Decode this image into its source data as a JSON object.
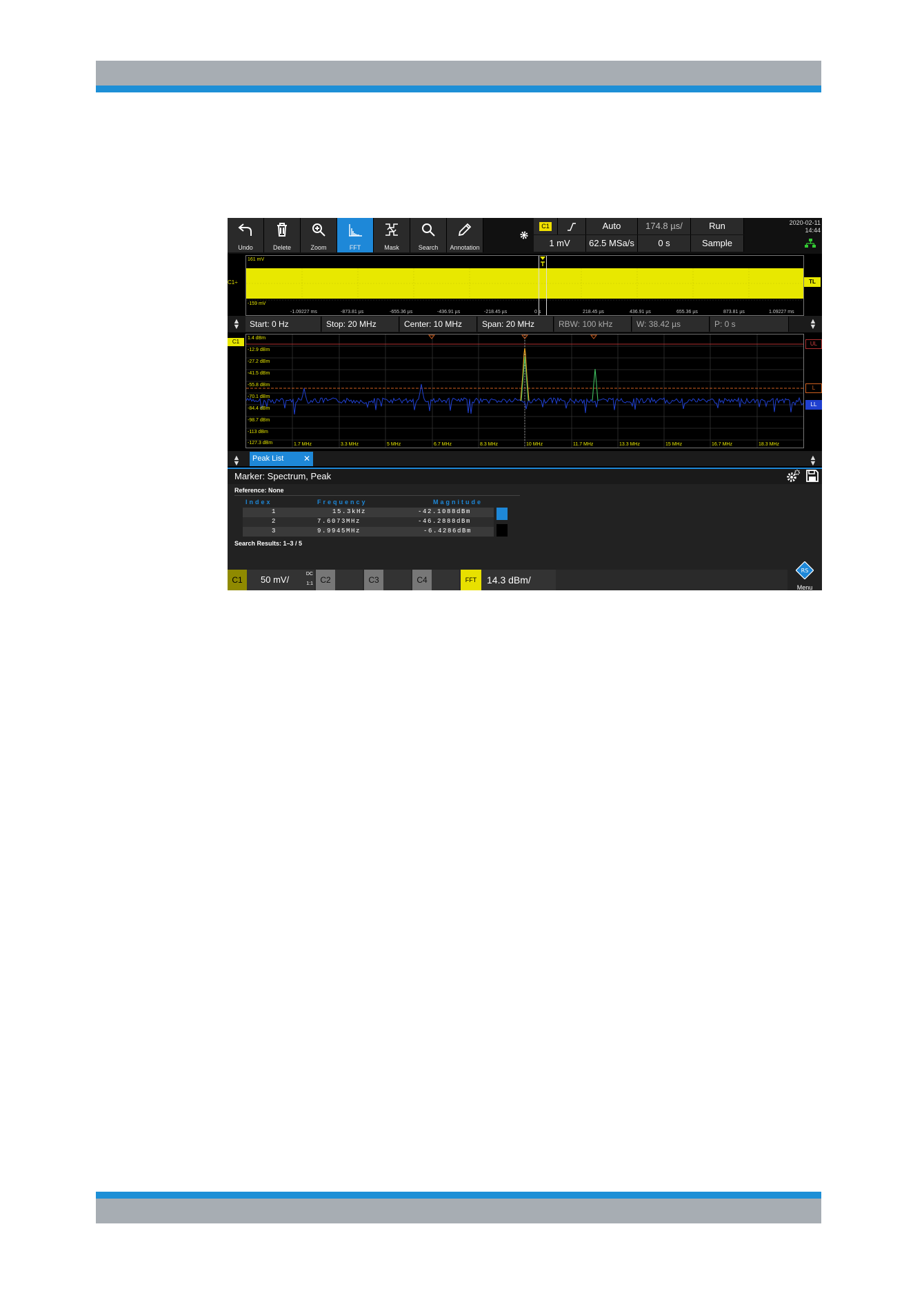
{
  "toolbar": {
    "buttons": [
      {
        "label": "Undo",
        "icon": "undo-icon"
      },
      {
        "label": "Delete",
        "icon": "trash-icon"
      },
      {
        "label": "Zoom",
        "icon": "zoom-icon"
      },
      {
        "label": "FFT",
        "icon": "fft-icon",
        "active": true
      },
      {
        "label": "Mask",
        "icon": "mask-icon"
      },
      {
        "label": "Search",
        "icon": "search-icon"
      },
      {
        "label": "Annotation",
        "icon": "pen-icon"
      }
    ],
    "accent_color": "#1e88d8"
  },
  "trigger": {
    "source": "C1",
    "mode": "Auto",
    "time_scale": "174.8 µs/",
    "run": "Run",
    "level": "1 mV",
    "sample_rate": "62.5 MSa/s",
    "position": "0 s",
    "acquire": "Sample"
  },
  "datetime": {
    "date": "2020-02-11",
    "time": "14:44"
  },
  "waveform": {
    "top_label": "161 mV",
    "bottom_label": "-159 mV",
    "channel": "C1",
    "trigger_level_tag": "TL",
    "channel_color": "#e8e800",
    "time_ticks": [
      "-1.09227 ms",
      "-873.81 µs",
      "-655.36 µs",
      "-436.91 µs",
      "-218.45 µs",
      "0 s",
      "218.45 µs",
      "436.91 µs",
      "655.36 µs",
      "873.81 µs",
      "1.09227 ms"
    ]
  },
  "spectrum_bar": {
    "start": "Start: 0 Hz",
    "stop": "Stop: 20 MHz",
    "center": "Center: 10 MHz",
    "span": "Span: 20 MHz",
    "rbw": "RBW: 100 kHz",
    "w": "W: 38.42 µs",
    "p": "P: 0 s"
  },
  "spectrum": {
    "y_labels": [
      "1.4 dBm",
      "-12.9 dBm",
      "-27.2 dBm",
      "-41.5 dBm",
      "-55.8 dBm",
      "-70.1 dBm",
      "-84.4 dBm",
      "-98.7 dBm",
      "-113 dBm",
      "-127.3 dBm"
    ],
    "x_labels": [
      "1.7 MHz",
      "3.3 MHz",
      "5 MHz",
      "6.7 MHz",
      "8.3 MHz",
      "10 MHz",
      "11.7 MHz",
      "13.3 MHz",
      "15 MHz",
      "16.7 MHz",
      "18.3 MHz"
    ],
    "channel": "C1",
    "ul_tag": "UL",
    "l_tag": "L",
    "ll_tag": "LL",
    "trace_color": "#2040d0"
  },
  "peak_list": {
    "tab_label": "Peak List",
    "title": "Marker: Spectrum, Peak",
    "reference": "Reference: None",
    "columns": [
      "Index",
      "Frequency",
      "Magnitude"
    ],
    "rows": [
      {
        "index": "1",
        "frequency": "15.3kHz",
        "magnitude": "-42.1088dBm"
      },
      {
        "index": "2",
        "frequency": "7.6073MHz",
        "magnitude": "-46.2888dBm"
      },
      {
        "index": "3",
        "frequency": "9.9945MHz",
        "magnitude": "-6.4286dBm"
      }
    ],
    "results": "Search Results:  1–3 / 5"
  },
  "bottom_bar": {
    "c1": "C1",
    "c1_scale": "50 mV/",
    "c1_coupling": "DC",
    "c1_probe": "1:1",
    "c2": "C2",
    "c3": "C3",
    "c4": "C4",
    "fft": "FFT",
    "fft_scale": "14.3 dBm/",
    "menu": "Menu"
  }
}
